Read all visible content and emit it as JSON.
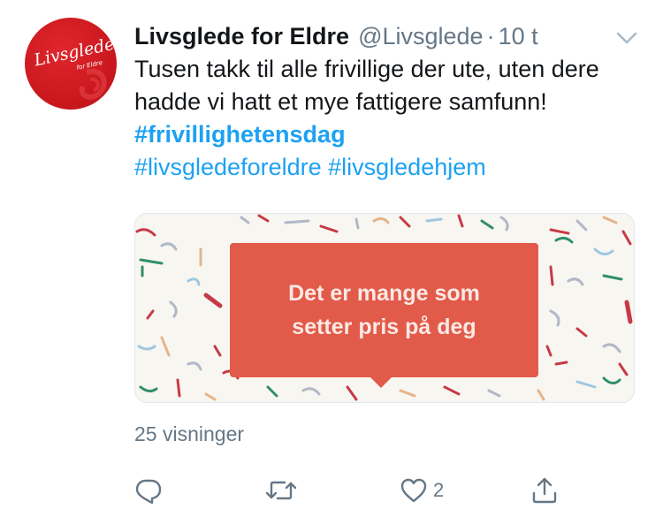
{
  "account": {
    "display_name": "Livsglede for Eldre",
    "handle": "@Livsglede",
    "separator": "·",
    "time": "10 t",
    "logo_text": "Livsglede",
    "logo_subtext": "for Eldre"
  },
  "tweet": {
    "text_before": "Tusen takk til alle frivillige der ute, uten dere hadde vi hatt et mye fattigere samfunn! ",
    "hashtag_1": "#frivillighetensdag",
    "hashtag_2": "#livsgledeforeldre",
    "hashtag_3": "#livsgledehjem"
  },
  "card": {
    "line_1": "Det er mange som",
    "line_2": "setter pris på deg"
  },
  "stats": {
    "views": "25 visninger"
  },
  "actions": {
    "reply_icon": "reply-icon",
    "retweet_icon": "retweet-icon",
    "like_icon": "heart-icon",
    "like_count": "2",
    "share_icon": "share-icon"
  },
  "colors": {
    "link": "#1da1f2",
    "secondary_text": "#657786",
    "brand_red": "#c8161d",
    "bubble": "#e25a4a"
  }
}
